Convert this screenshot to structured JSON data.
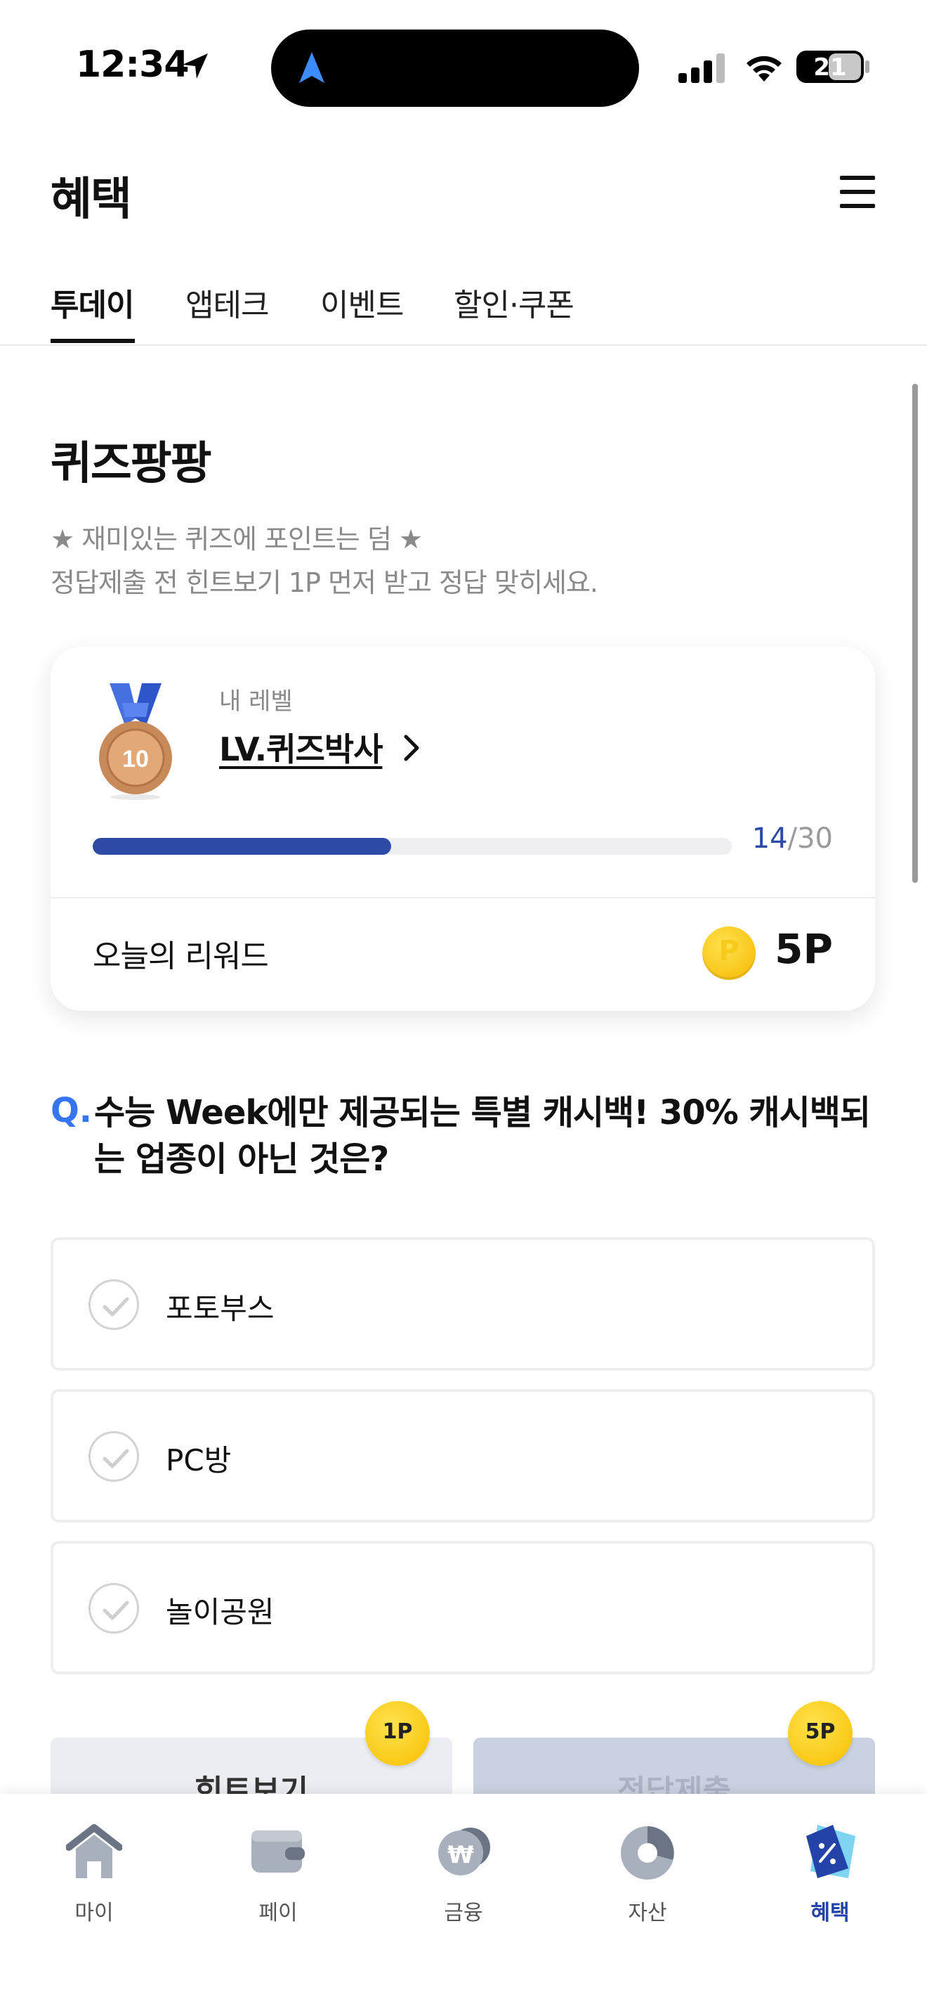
{
  "status_bar": {
    "time": "12:34",
    "battery": "21"
  },
  "header": {
    "title": "혜택"
  },
  "tabs": [
    {
      "label": "투데이",
      "active": true
    },
    {
      "label": "앱테크",
      "active": false
    },
    {
      "label": "이벤트",
      "active": false
    },
    {
      "label": "할인·쿠폰",
      "active": false
    }
  ],
  "quiz": {
    "title": "퀴즈팡팡",
    "desc_line1": "★ 재미있는 퀴즈에 포인트는 덤 ★",
    "desc_line2": "정답제출 전 힌트보기 1P 먼저 받고 정답 맞히세요."
  },
  "level_card": {
    "caption": "내 레벨",
    "level_name": "LV.퀴즈박사",
    "medal_number": "10",
    "progress_current": "14",
    "progress_total": "/30",
    "progress_fraction": 0.4667,
    "reward_label": "오늘의 리워드",
    "coin_letter": "P",
    "reward_value": "5P"
  },
  "question": {
    "marker": "Q.",
    "text": "수능 Week에만 제공되는 특별 캐시백! 30% 캐시백되는 업종이 아닌 것은?"
  },
  "options": [
    {
      "label": "포토부스"
    },
    {
      "label": "PC방"
    },
    {
      "label": "놀이공원"
    }
  ],
  "actions": {
    "hint_label": "힌트보기",
    "hint_badge": "1P",
    "submit_label": "정답제출",
    "submit_badge": "5P"
  },
  "bottom_nav": [
    {
      "label": "마이",
      "icon": "home-icon",
      "active": false
    },
    {
      "label": "페이",
      "icon": "wallet-icon",
      "active": false
    },
    {
      "label": "금융",
      "icon": "won-coin-icon",
      "active": false
    },
    {
      "label": "자산",
      "icon": "pie-chart-icon",
      "active": false
    },
    {
      "label": "혜택",
      "icon": "coupon-icon",
      "active": true
    }
  ],
  "colors": {
    "accent_blue": "#2c4aa6",
    "question_marker": "#3575f2",
    "coin_gold": "#f5b800",
    "active_nav": "#2443a8"
  }
}
